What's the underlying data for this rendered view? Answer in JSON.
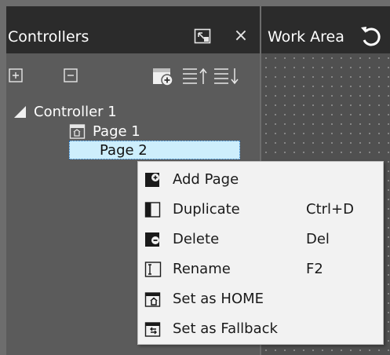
{
  "controllers_panel": {
    "title": "Controllers",
    "pin_icon": "pin-window-icon",
    "close_icon": "close-icon",
    "close_glyph": "×"
  },
  "toolbar": {
    "expand_icon": "expand-all-icon",
    "collapse_icon": "collapse-all-icon",
    "add_page_icon": "add-page-icon",
    "move_up_icon": "move-up-icon",
    "move_down_icon": "move-down-icon"
  },
  "tree": {
    "controller": "Controller 1",
    "pages": [
      {
        "label": "Page 1",
        "icon": "home-page-icon"
      },
      {
        "label": "Page 2",
        "selected": true
      }
    ]
  },
  "work_area": {
    "title": "Work Area",
    "undo_icon": "undo-icon"
  },
  "context_menu": {
    "items": [
      {
        "label": "Add Page",
        "shortcut": "",
        "icon": "add-page-icon"
      },
      {
        "label": "Duplicate",
        "shortcut": "Ctrl+D",
        "icon": "duplicate-icon"
      },
      {
        "label": "Delete",
        "shortcut": "Del",
        "icon": "delete-icon"
      },
      {
        "label": "Rename",
        "shortcut": "F2",
        "icon": "rename-icon"
      },
      {
        "label": "Set as HOME",
        "shortcut": "",
        "icon": "set-home-icon"
      },
      {
        "label": "Set as Fallback",
        "shortcut": "",
        "icon": "set-fallback-icon"
      }
    ]
  },
  "colors": {
    "header_bg": "#2b2b2b",
    "panel_bg": "#5b5b5b",
    "selection_bg": "#cdeefc",
    "menu_bg": "#f2f2f2"
  }
}
